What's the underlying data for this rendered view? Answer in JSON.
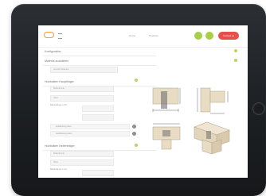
{
  "app": {
    "nav": [
      "Home",
      "Products"
    ],
    "cta_label": "Contact us"
  },
  "sections": [
    {
      "title": "Konfiguration"
    },
    {
      "title": "Material auswählen"
    },
    {
      "title": "Auswahl Material"
    },
    {
      "title": "Holzbalken Hauptträger"
    },
    {
      "title": "Holzbalken Nebenträger"
    }
  ],
  "fields": {
    "main_width": "Balkenbreite",
    "main_height": "Höhe",
    "main_extra_label": "Balkenlänge in mm",
    "cb1": "Ausklinkung oben",
    "cb2": "Ausklinkung unten",
    "side_width": "Balkenbreite",
    "side_height": "Höhe",
    "side_extra_label": "Balkenlänge in mm"
  },
  "drawings": [
    "front-view",
    "side-view",
    "top-view",
    "3d-view"
  ],
  "colors": {
    "accent_orange": "#f39a3c",
    "accent_green": "#a6cf46",
    "accent_red": "#e94e4a",
    "bezel": "#1e2226"
  }
}
